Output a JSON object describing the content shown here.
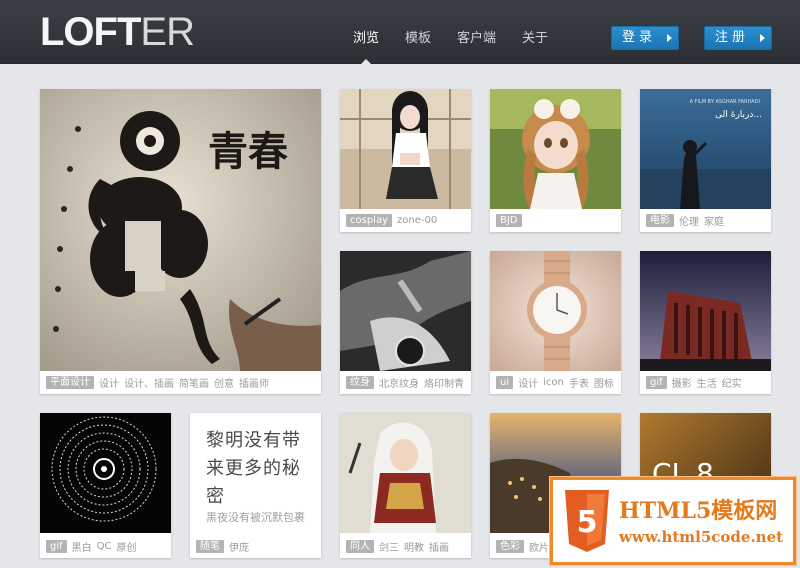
{
  "header": {
    "logo_left": "LOFT",
    "logo_right": "ER",
    "nav": [
      "浏览",
      "模板",
      "客户端",
      "关于"
    ],
    "login_label": "登录",
    "register_label": "注册"
  },
  "cards": {
    "c1": {
      "tags": [
        "平面设计",
        "设计",
        "设计、插画",
        "简笔画",
        "创意",
        "插画师"
      ],
      "title_art": "青春"
    },
    "c2": {
      "tags": [
        "cosplay",
        "zone-00"
      ]
    },
    "c3": {
      "tags": [
        "BJD"
      ]
    },
    "c4": {
      "tags": [
        "电影",
        "伦理",
        "家庭"
      ],
      "poster_text": "دربارهٔ الی...",
      "poster_top": "A FILM BY ASGHAR FARHADI"
    },
    "c5": {
      "tags": [
        "纹身",
        "北京纹身",
        "烙印制青"
      ]
    },
    "c6": {
      "tags": [
        "ui",
        "设计",
        "icon",
        "手表",
        "图标"
      ]
    },
    "c7": {
      "tags": [
        "gif",
        "摄影",
        "生活",
        "纪实"
      ]
    },
    "c8": {
      "tags": [
        "gif",
        "黑白",
        "QC",
        "原创"
      ]
    },
    "c9": {
      "text": "黎明没有带来更多的秘密",
      "sub": "黑夜没有被沉默包裹",
      "tags": [
        "随笔",
        "伊庞"
      ]
    },
    "c10": {
      "tags": [
        "同人",
        "剑三",
        "明教",
        "插画"
      ]
    },
    "c11": {
      "tags": [
        "色彩",
        "欧片"
      ]
    },
    "c12": {
      "overlay": "CL 8"
    }
  },
  "watermark": {
    "line1": "HTML5模板网",
    "line2": "www.html5code.net",
    "badge": "5"
  }
}
